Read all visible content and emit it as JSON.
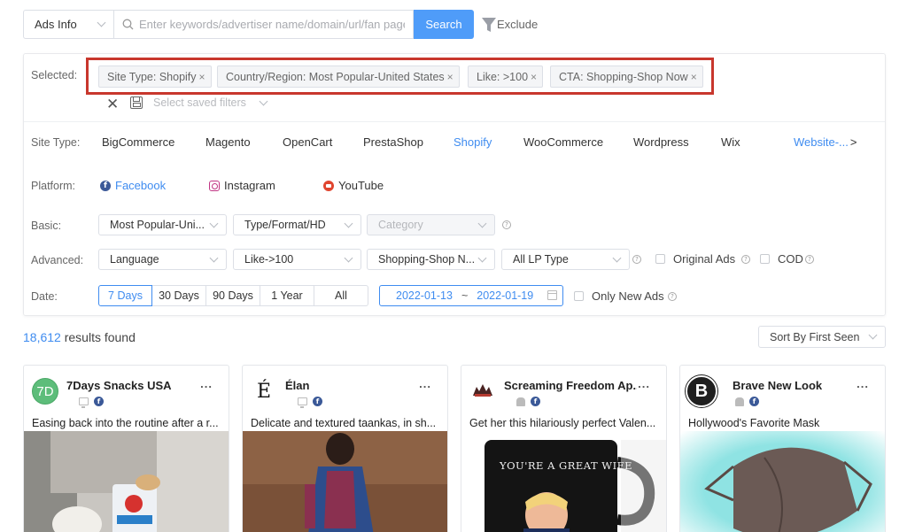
{
  "search": {
    "type_select": "Ads Info",
    "placeholder": "Enter keywords/advertiser name/domain/url/fan page",
    "button": "Search",
    "exclude": "Exclude"
  },
  "filters": {
    "selected_label": "Selected:",
    "chips": [
      "Site Type: Shopify",
      "Country/Region: Most Popular-United States",
      "Like: >100",
      "CTA: Shopping-Shop Now"
    ],
    "chip_close": "×",
    "saved_filters_placeholder": "Select saved filters",
    "site_type": {
      "label": "Site Type:",
      "options": [
        "BigCommerce",
        "Magento",
        "OpenCart",
        "PrestaShop",
        "Shopify",
        "WooCommerce",
        "Wordpress",
        "Wix"
      ],
      "more": "Website-...",
      "more_arrow": ">"
    },
    "platform": {
      "label": "Platform:",
      "options": [
        "Facebook",
        "Instagram",
        "YouTube"
      ]
    },
    "basic": {
      "label": "Basic:",
      "country": "Most Popular-Uni...",
      "type": "Type/Format/HD",
      "category": "Category"
    },
    "advanced": {
      "label": "Advanced:",
      "language": "Language",
      "like": "Like->100",
      "cta": "Shopping-Shop N...",
      "lp_type": "All LP Type",
      "original_ads": "Original Ads",
      "cod": "COD"
    },
    "date": {
      "label": "Date:",
      "ranges": [
        "7 Days",
        "30 Days",
        "90 Days",
        "1 Year",
        "All"
      ],
      "start": "2022-01-13",
      "separator": "~",
      "end": "2022-01-19",
      "only_new": "Only New Ads"
    },
    "help_glyph": "?"
  },
  "results": {
    "count": "18,612",
    "suffix": " results found",
    "sort": "Sort By First Seen"
  },
  "cards": [
    {
      "name": "7Days Snacks USA",
      "avatar": "7D",
      "desc": "Easing back into the routine after a r...",
      "more": "..."
    },
    {
      "name": "Élan",
      "avatar": "É",
      "desc": "Delicate and textured taankas, in sh...",
      "more": "..."
    },
    {
      "name": "Screaming Freedom Ap...",
      "avatar": "",
      "desc": "Get her this hilariously perfect Valen...",
      "more": "...",
      "mug_text": "YOU'RE A GREAT WIFE"
    },
    {
      "name": "Brave New Look",
      "avatar": "B",
      "desc": "Hollywood's Favorite Mask",
      "more": "..."
    }
  ],
  "colors": {
    "accent": "#3f8cf0",
    "search_button": "#4f9cf9",
    "highlight": "#c8372d",
    "facebook": "#3b5998"
  }
}
